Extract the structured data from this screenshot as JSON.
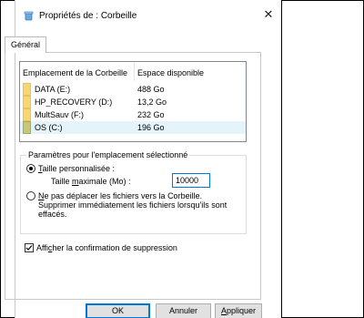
{
  "window": {
    "title": "Propriétés de : Corbeille",
    "close_glyph": "✕"
  },
  "tabs": [
    {
      "label": "Général"
    }
  ],
  "list": {
    "headers": {
      "location": "Emplacement de la Corbeille",
      "space": "Espace disponible"
    },
    "rows": [
      {
        "name": "DATA (E:)",
        "space": "488 Go",
        "icon": "drive-icon"
      },
      {
        "name": "HP_RECOVERY (D:)",
        "space": "13,2 Go",
        "icon": "drive-icon"
      },
      {
        "name": "MultSauv (F:)",
        "space": "232 Go",
        "icon": "drive-icon"
      },
      {
        "name": "OS (C:)",
        "space": "196 Go",
        "icon": "os-drive-icon",
        "selected": true
      }
    ]
  },
  "settings": {
    "group_title": "Paramètres pour l'emplacement sélectionné",
    "custom_size": {
      "access_key": "T",
      "rest": "aille personnalisée :",
      "checked": true
    },
    "max_size": {
      "prefix": "Taille ",
      "access_key": "m",
      "rest": "aximale (Mo) :",
      "value": "10000"
    },
    "no_move": {
      "access_key": "N",
      "rest": "e pas déplacer les fichiers vers la Corbeille.",
      "line2": "Supprimer immédiatement les fichiers lorsqu'ils sont",
      "line3": "effacés.",
      "checked": false
    },
    "confirm": {
      "prefix": "Affi",
      "access_key": "c",
      "rest": "her la confirmation de suppression",
      "checked": true
    }
  },
  "buttons": {
    "ok": "OK",
    "cancel": "Annuler",
    "apply_key": "A",
    "apply_rest": "ppliquer"
  },
  "colors": {
    "accent": "#0078d7",
    "selection": "#e5f3fb",
    "folder": "#f7d774"
  }
}
